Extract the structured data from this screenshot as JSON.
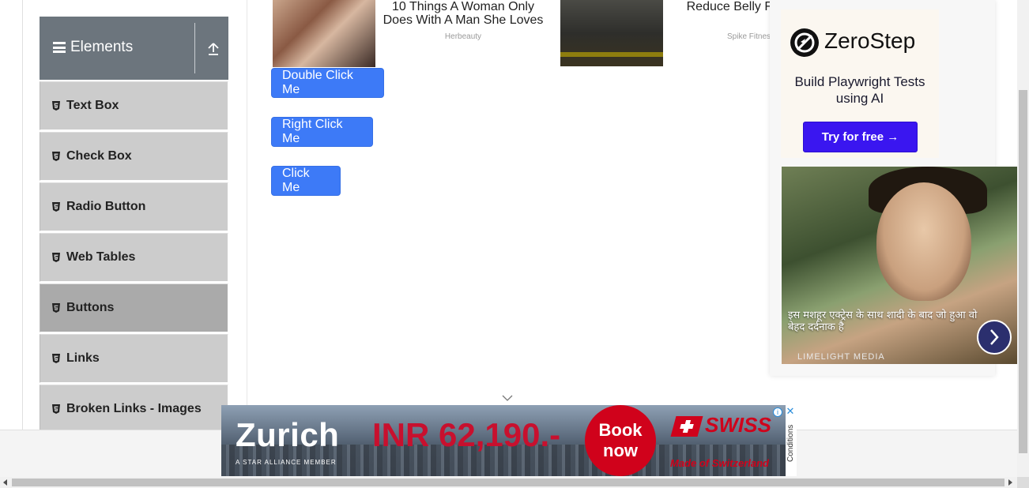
{
  "sidebar": {
    "group_title": "Elements",
    "items": [
      {
        "label": "Text Box"
      },
      {
        "label": "Check Box"
      },
      {
        "label": "Radio Button"
      },
      {
        "label": "Web Tables"
      },
      {
        "label": "Buttons",
        "active": true
      },
      {
        "label": "Links"
      },
      {
        "label": "Broken Links - Images"
      }
    ]
  },
  "top_ads": [
    {
      "headline": "10 Things A Woman Only Does With A Man She Loves",
      "source": "Herbeauty"
    },
    {
      "headline": "Reduce Belly Fat Days",
      "source": "Spike Fitness"
    }
  ],
  "buttons": {
    "double_click": "Double Click Me",
    "right_click": "Right Click Me",
    "click": "Click Me"
  },
  "right_ad": {
    "brand": "ZeroStep",
    "tagline": "Build Playwright Tests using AI",
    "cta": "Try for free →",
    "story_caption": "इस मशहूर एक्ट्रेस के साथ शादी के बाद जो हुआ वो बेहद दर्दनाक है",
    "story_source": "LIMELIGHT MEDIA"
  },
  "banner": {
    "city": "Zurich",
    "price": "INR 62,190.-",
    "book_line1": "Book",
    "book_line2": "now",
    "airline": "SWISS",
    "alliance": "A STAR ALLIANCE MEMBER",
    "made_in": "Made of Switzerland",
    "conditions": "Conditions",
    "close_symbol": "✕",
    "info_symbol": "i"
  },
  "colors": {
    "primary_button": "#3d7af7",
    "sidebar_header": "#6c757d",
    "menu_item": "#cccccc",
    "menu_active": "#aaaaaa",
    "zs_cta": "#3a16f0",
    "swiss_red": "#d0021b"
  }
}
